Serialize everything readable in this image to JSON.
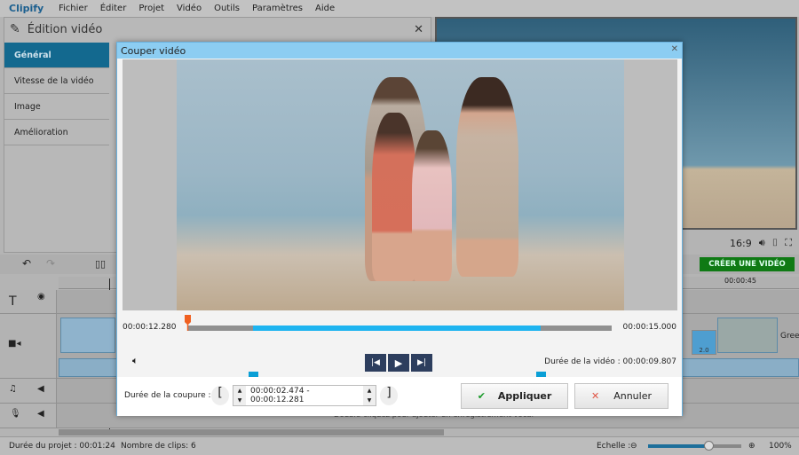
{
  "app": {
    "name": "Clipify",
    "menu": [
      "Fichier",
      "Éditer",
      "Projet",
      "Vidéo",
      "Outils",
      "Paramètres",
      "Aide"
    ]
  },
  "editor": {
    "title": "Édition vidéo",
    "tabs": [
      {
        "label": "Général",
        "active": true
      },
      {
        "label": "Vitesse de la vidéo"
      },
      {
        "label": "Image"
      },
      {
        "label": "Amélioration"
      }
    ]
  },
  "preview": {
    "aspect": "16:9",
    "create_label": "CRÉER UNE VIDÉO"
  },
  "timeline": {
    "ruler_label": "00:00:45",
    "clip_label": "Gree",
    "transition": "2.0",
    "voice_hint": "Double-cliquez pour ajouter un enregistrement vocal"
  },
  "dialog": {
    "title": "Couper vidéo",
    "current_time": "00:00:12.280",
    "end_time": "00:00:15.000",
    "duration_label": "Durée de la vidéo : 00:00:09.807",
    "playhead_fraction": 0.0,
    "selection_start_fraction": 0.155,
    "selection_end_fraction": 0.833,
    "cut_label": "Durée de la coupure :",
    "cut_value": "00:00:02.474 - 00:00:12.281",
    "apply": "Appliquer",
    "cancel": "Annuler"
  },
  "status": {
    "project_duration": "Durée du projet :  00:01:24",
    "clips": "Nombre de clips: 6",
    "scale_label": "Echelle :",
    "zoom": "100%",
    "zoom_fraction": 0.65
  },
  "colors": {
    "accent": "#13698f",
    "selection": "#1eb4f0",
    "create": "#0f7a14",
    "title_bar": "#8ccdf2"
  }
}
